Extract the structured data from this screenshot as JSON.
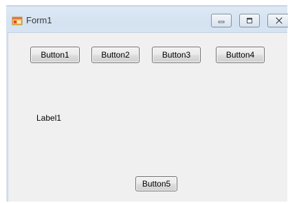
{
  "window": {
    "title": "Form1",
    "controls": {
      "minimize_icon": "minimize-icon",
      "maximize_icon": "maximize-icon",
      "close_icon": "close-icon"
    }
  },
  "form": {
    "buttons": [
      "Button1",
      "Button2",
      "Button3",
      "Button4"
    ],
    "label": "Label1",
    "bottom_button": "Button5"
  },
  "colors": {
    "title_bar": "#d4e2f1",
    "client_area": "#f0f0f0",
    "button_border": "#707070"
  }
}
